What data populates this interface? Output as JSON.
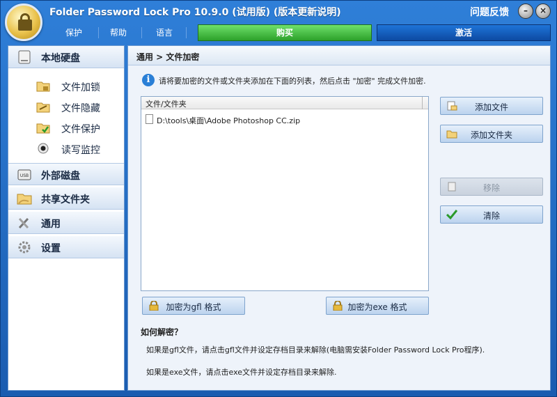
{
  "window": {
    "title": "Folder Password Lock Pro 10.9.0 (试用版) (版本更新说明)",
    "feedback": "问题反馈",
    "minimize_glyph": "–",
    "close_glyph": "×"
  },
  "menu": {
    "items": [
      {
        "label": "保护"
      },
      {
        "label": "帮助"
      },
      {
        "label": "语言"
      }
    ],
    "buy_label": "购买",
    "activate_label": "激活"
  },
  "sidebar": {
    "categories": [
      {
        "label": "本地硬盘",
        "icon": "hard-drive-icon"
      },
      {
        "label": "外部磁盘",
        "icon": "usb-drive-icon"
      },
      {
        "label": "共享文件夹",
        "icon": "shared-folder-icon"
      },
      {
        "label": "通用",
        "icon": "tools-icon"
      },
      {
        "label": "设置",
        "icon": "gear-icon"
      }
    ],
    "local_items": [
      {
        "label": "文件加锁",
        "icon": "lock-folder-icon"
      },
      {
        "label": "文件隐藏",
        "icon": "hide-folder-icon"
      },
      {
        "label": "文件保护",
        "icon": "protect-folder-icon"
      },
      {
        "label": "读写监控",
        "icon": "monitor-icon"
      }
    ]
  },
  "content": {
    "breadcrumb": "通用 > 文件加密",
    "info_text": "请将要加密的文件或文件夹添加在下面的列表，然后点击 \"加密\" 完成文件加密.",
    "list_header": "文件/文件夹",
    "files": [
      "D:\\tools\\桌面\\Adobe Photoshop CC.zip"
    ],
    "buttons": {
      "add_file": "添加文件",
      "add_folder": "添加文件夹",
      "remove": "移除",
      "clear": "清除",
      "encrypt_gfl": "加密为gfl 格式",
      "encrypt_exe": "加密为exe 格式"
    },
    "howto_title": "如何解密？",
    "howto_line1": "如果是gfl文件，请点击gfl文件并设定存档目录来解除(电脑需安装Folder Password Lock Pro程序).",
    "howto_line2": "如果是exe文件，请点击exe文件并设定存档目录来解除."
  },
  "colors": {
    "titlebar": "#2f7fd8",
    "buy_green": "#2da12a",
    "activate_blue": "#0d4aa2"
  }
}
